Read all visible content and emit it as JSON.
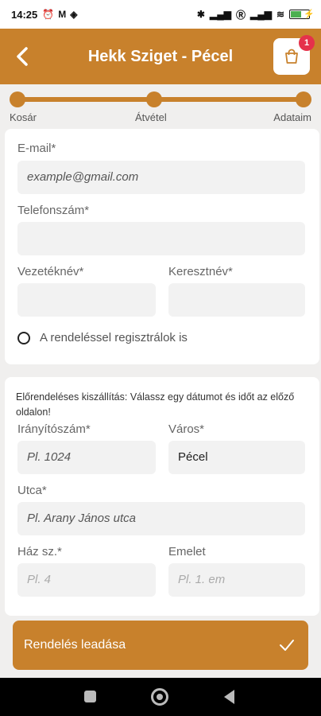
{
  "status": {
    "time": "14:25",
    "left_icons": [
      "alarm-icon",
      "gmail-icon",
      "vpn-icon"
    ],
    "right_icons": [
      "bluetooth-icon",
      "signal-icon",
      "roaming-icon",
      "signal-icon",
      "wifi-icon",
      "battery-icon"
    ]
  },
  "header": {
    "title": "Hekk Sziget - Pécel",
    "cart_count": "1",
    "accent_color": "#c8812c"
  },
  "progress": {
    "steps": [
      "Kosár",
      "Átvétel",
      "Adataim"
    ]
  },
  "contact": {
    "email_label": "E-mail*",
    "email_placeholder": "example@gmail.com",
    "phone_label": "Telefonszám*",
    "phone_value": "",
    "lastname_label": "Vezetéknév*",
    "lastname_value": "",
    "firstname_label": "Keresztnév*",
    "firstname_value": "",
    "register_label": "A rendeléssel regisztrálok is"
  },
  "delivery": {
    "note": "Előrendeléses kiszállítás: Válassz egy dátumot és időt az előző oldalon!",
    "zip_label": "Irányítószám*",
    "zip_placeholder": "Pl. 1024",
    "city_label": "Város*",
    "city_value": "Pécel",
    "street_label": "Utca*",
    "street_placeholder": "Pl. Arany János utca",
    "house_label": "Ház sz.*",
    "house_placeholder": "Pl. 4",
    "floor_label": "Emelet",
    "floor_placeholder": "Pl. 1. em"
  },
  "submit": {
    "label": "Rendelés leadása"
  }
}
